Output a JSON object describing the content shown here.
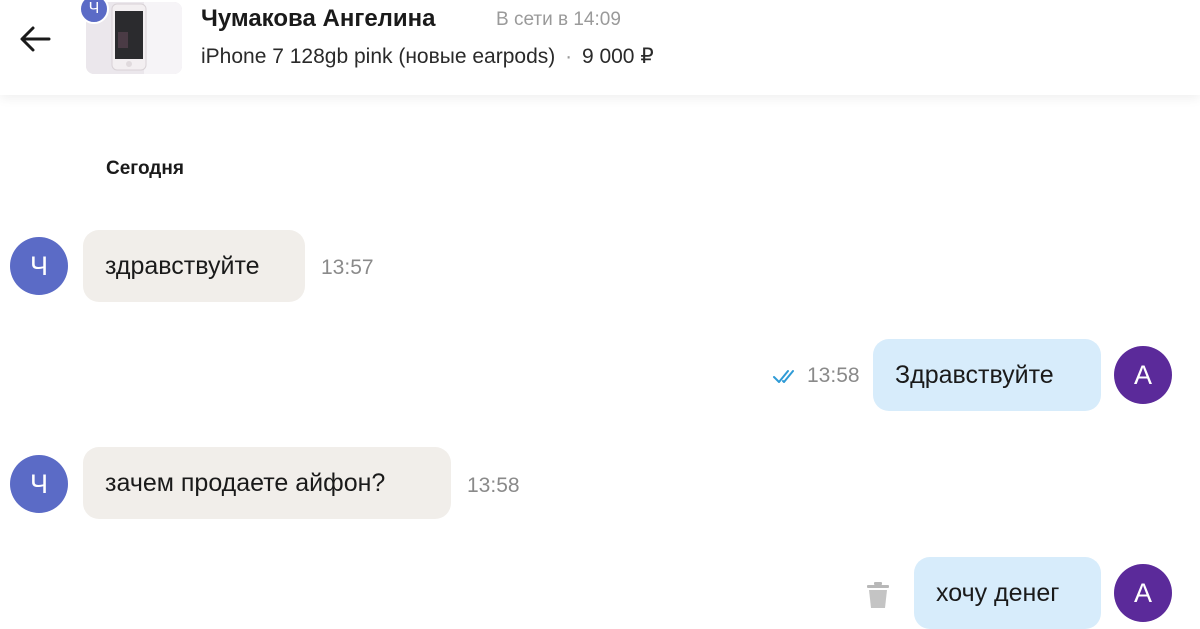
{
  "header": {
    "back_icon": "arrow-left-icon",
    "seller_avatar_letter": "Ч",
    "seller_name": "Чумакова Ангелина",
    "status": "В сети в 14:09",
    "listing_title": "iPhone 7 128gb pink (новые earpods)",
    "separator": "·",
    "price": "9 000 ₽"
  },
  "chat": {
    "date_separator": "Сегодня",
    "messages": [
      {
        "direction": "incoming",
        "avatar": "Ч",
        "text": "здравствуйте",
        "time": "13:57"
      },
      {
        "direction": "outgoing",
        "avatar": "А",
        "text": "Здравствуйте",
        "time": "13:58",
        "read_icon": "double-check-icon"
      },
      {
        "direction": "incoming",
        "avatar": "Ч",
        "text": "зачем продаете айфон?",
        "time": "13:58"
      },
      {
        "direction": "outgoing",
        "avatar": "А",
        "text": "хочу денег",
        "action_icon": "trash-icon"
      }
    ]
  },
  "colors": {
    "incoming_avatar": "#5b6bc6",
    "outgoing_avatar": "#5b2a9a",
    "incoming_bubble": "#f1eeea",
    "outgoing_bubble": "#d7ecfb",
    "read_check": "#2f9bd6"
  }
}
